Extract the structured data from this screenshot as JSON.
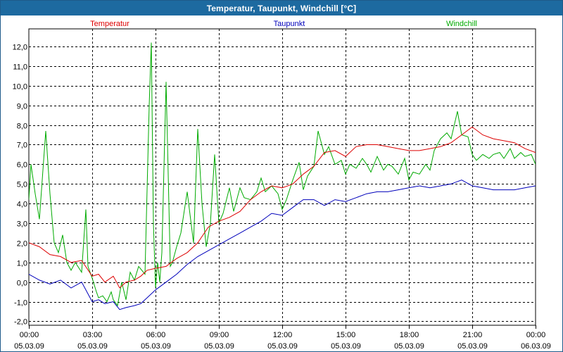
{
  "window": {
    "title": "Temperatur, Taupunkt, Windchill [°C]"
  },
  "chart_data": {
    "type": "line",
    "title": "Temperatur, Taupunkt, Windchill [°C]",
    "ylim": [
      -2.2,
      12.9
    ],
    "y_ticks": [
      -2.0,
      -1.0,
      0.0,
      1.0,
      2.0,
      3.0,
      4.0,
      5.0,
      6.0,
      7.0,
      8.0,
      9.0,
      10.0,
      11.0,
      12.0
    ],
    "y_tick_labels": [
      "-2,0",
      "-1,0",
      "0,0",
      "1,0",
      "2,0",
      "3,0",
      "4,0",
      "5,0",
      "6,0",
      "7,0",
      "8,0",
      "9,0",
      "10,0",
      "11,0",
      "12,0"
    ],
    "xlim": [
      0,
      24
    ],
    "x_ticks": [
      0,
      3,
      6,
      9,
      12,
      15,
      18,
      21,
      24
    ],
    "x_tick_labels": [
      [
        "00:00",
        "05.03.09"
      ],
      [
        "03:00",
        "05.03.09"
      ],
      [
        "06:00",
        "05.03.09"
      ],
      [
        "09:00",
        "05.03.09"
      ],
      [
        "12:00",
        "05.03.09"
      ],
      [
        "15:00",
        "05.03.09"
      ],
      [
        "18:00",
        "05.03.09"
      ],
      [
        "21:00",
        "05.03.09"
      ],
      [
        "00:00",
        "06.03.09"
      ]
    ],
    "grid": true,
    "legend_position": "top",
    "series": [
      {
        "name": "Temperatur",
        "color": "#dd0000",
        "x": [
          0,
          0.5,
          1,
          1.5,
          2,
          2.5,
          3,
          3.3,
          3.6,
          4,
          4.3,
          4.6,
          5,
          5.3,
          5.6,
          6,
          6.5,
          7,
          7.5,
          8,
          8.5,
          9,
          9.5,
          10,
          10.5,
          11,
          11.5,
          12,
          12.5,
          13,
          13.5,
          14,
          14.5,
          15,
          15.5,
          16,
          16.5,
          17,
          17.5,
          18,
          18.5,
          19,
          19.5,
          20,
          20.5,
          21,
          21.5,
          22,
          22.5,
          23,
          23.5,
          24
        ],
        "y": [
          2.0,
          1.8,
          1.4,
          1.3,
          1.0,
          1.1,
          0.3,
          0.4,
          0.0,
          0.3,
          -0.3,
          0.0,
          0.1,
          0.3,
          0.6,
          0.7,
          0.8,
          1.2,
          1.5,
          2.0,
          2.8,
          3.1,
          3.3,
          3.6,
          4.2,
          4.6,
          4.9,
          4.8,
          5.0,
          5.5,
          5.9,
          6.6,
          6.7,
          6.4,
          6.9,
          7.0,
          7.0,
          6.9,
          6.8,
          6.7,
          6.7,
          6.8,
          6.9,
          7.1,
          7.5,
          7.9,
          7.5,
          7.3,
          7.2,
          7.1,
          6.8,
          6.6
        ]
      },
      {
        "name": "Taupunkt",
        "color": "#0000bb",
        "x": [
          0,
          0.5,
          1,
          1.5,
          2,
          2.5,
          3,
          3.3,
          3.6,
          4,
          4.3,
          4.6,
          5,
          5.3,
          5.6,
          6,
          6.5,
          7,
          7.5,
          8,
          8.5,
          9,
          9.5,
          10,
          10.5,
          11,
          11.5,
          12,
          12.5,
          13,
          13.5,
          14,
          14.5,
          15,
          15.5,
          16,
          16.5,
          17,
          17.5,
          18,
          18.5,
          19,
          19.5,
          20,
          20.5,
          21,
          21.5,
          22,
          22.5,
          23,
          23.5,
          24
        ],
        "y": [
          0.4,
          0.1,
          -0.1,
          0.1,
          -0.3,
          0.0,
          -1.0,
          -0.9,
          -1.1,
          -1.0,
          -1.4,
          -1.3,
          -1.2,
          -1.1,
          -0.8,
          -0.4,
          0.0,
          0.4,
          0.9,
          1.3,
          1.6,
          1.9,
          2.2,
          2.5,
          2.8,
          3.1,
          3.5,
          3.4,
          3.8,
          4.2,
          4.2,
          3.9,
          4.2,
          4.1,
          4.3,
          4.5,
          4.6,
          4.6,
          4.7,
          4.8,
          4.9,
          4.8,
          4.9,
          5.0,
          5.2,
          4.9,
          4.8,
          4.7,
          4.7,
          4.7,
          4.8,
          4.9
        ]
      },
      {
        "name": "Windchill",
        "color": "#00aa00",
        "x": [
          0,
          0.1,
          0.3,
          0.5,
          0.8,
          1.0,
          1.2,
          1.4,
          1.6,
          1.8,
          2.0,
          2.2,
          2.5,
          2.7,
          2.8,
          3.0,
          3.2,
          3.3,
          3.5,
          3.7,
          3.9,
          4.0,
          4.2,
          4.4,
          4.6,
          4.8,
          5.0,
          5.2,
          5.5,
          5.7,
          5.8,
          5.9,
          6.0,
          6.1,
          6.2,
          6.3,
          6.5,
          6.7,
          6.8,
          7.0,
          7.2,
          7.5,
          7.8,
          8.0,
          8.2,
          8.4,
          8.6,
          8.8,
          9.0,
          9.2,
          9.5,
          9.7,
          10.0,
          10.2,
          10.5,
          10.8,
          11.0,
          11.2,
          11.5,
          11.8,
          12.0,
          12.2,
          12.5,
          12.8,
          13.0,
          13.2,
          13.5,
          13.7,
          14.0,
          14.2,
          14.5,
          14.8,
          15.0,
          15.2,
          15.5,
          15.8,
          16.0,
          16.2,
          16.5,
          16.8,
          17.0,
          17.2,
          17.5,
          17.8,
          18.0,
          18.2,
          18.5,
          18.8,
          19.0,
          19.2,
          19.5,
          19.8,
          20.0,
          20.3,
          20.5,
          20.8,
          21.0,
          21.2,
          21.5,
          21.8,
          22.0,
          22.3,
          22.5,
          22.8,
          23.0,
          23.3,
          23.5,
          23.8,
          24.0
        ],
        "y": [
          4.2,
          6.0,
          4.5,
          3.2,
          7.7,
          4.5,
          2.0,
          1.5,
          2.4,
          1.0,
          0.6,
          1.0,
          0.5,
          3.7,
          0.8,
          0.2,
          -0.5,
          -0.8,
          -0.7,
          -1.0,
          -0.5,
          -0.9,
          -1.2,
          0.0,
          -0.9,
          0.5,
          0.1,
          0.8,
          0.4,
          9.0,
          12.2,
          3.0,
          -0.3,
          1.0,
          0.0,
          1.5,
          10.2,
          0.8,
          1.0,
          1.8,
          2.5,
          4.6,
          2.0,
          7.8,
          4.0,
          1.8,
          3.0,
          6.5,
          3.0,
          3.5,
          4.8,
          3.6,
          4.8,
          4.3,
          4.2,
          4.6,
          5.3,
          4.6,
          4.9,
          4.5,
          3.7,
          4.2,
          5.2,
          6.1,
          4.7,
          5.4,
          5.9,
          7.7,
          6.5,
          6.9,
          6.0,
          6.2,
          5.5,
          6.0,
          5.8,
          6.3,
          6.0,
          5.6,
          6.4,
          5.7,
          6.0,
          5.9,
          5.5,
          6.3,
          5.2,
          5.6,
          5.5,
          6.0,
          5.7,
          6.7,
          7.3,
          7.6,
          7.3,
          8.7,
          7.5,
          7.4,
          6.5,
          6.2,
          6.5,
          6.3,
          6.5,
          6.6,
          6.3,
          6.8,
          6.3,
          6.6,
          6.4,
          6.5,
          6.0
        ]
      }
    ]
  }
}
